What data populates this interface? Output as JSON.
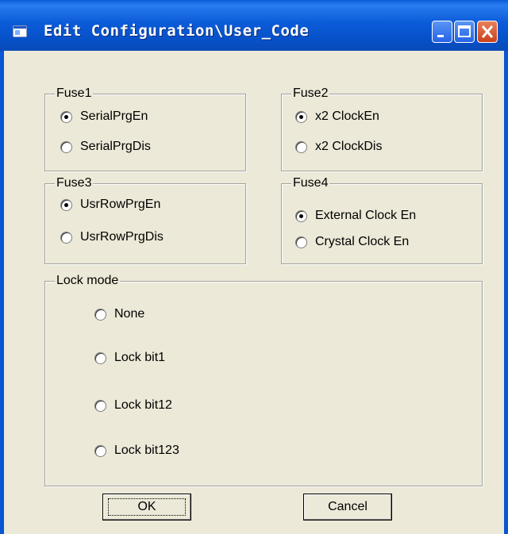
{
  "window": {
    "title": "Edit Configuration\\User_Code",
    "icon": "app-window-icon",
    "caption_buttons": [
      "minimize-icon",
      "maximize-icon",
      "close-icon"
    ]
  },
  "fuse1": {
    "label": "Fuse1",
    "options": [
      "SerialPrgEn",
      "SerialPrgDis"
    ],
    "selected": "SerialPrgEn"
  },
  "fuse2": {
    "label": "Fuse2",
    "options": [
      "x2 ClockEn",
      "x2 ClockDis"
    ],
    "selected": "x2 ClockEn"
  },
  "fuse3": {
    "label": "Fuse3",
    "options": [
      "UsrRowPrgEn",
      "UsrRowPrgDis"
    ],
    "selected": "UsrRowPrgEn"
  },
  "fuse4": {
    "label": "Fuse4",
    "options": [
      "External Clock En",
      "Crystal Clock En"
    ],
    "selected": "External Clock En"
  },
  "lock_mode": {
    "label": "Lock mode",
    "options": [
      "None",
      "Lock bit1",
      "Lock bit12",
      "Lock bit123"
    ],
    "selected": ""
  },
  "buttons": {
    "ok": "OK",
    "cancel": "Cancel"
  },
  "colors": {
    "title_bar": "#0a5ad8",
    "dialog_bg": "#ece9d8",
    "close_button": "#c8421c"
  }
}
